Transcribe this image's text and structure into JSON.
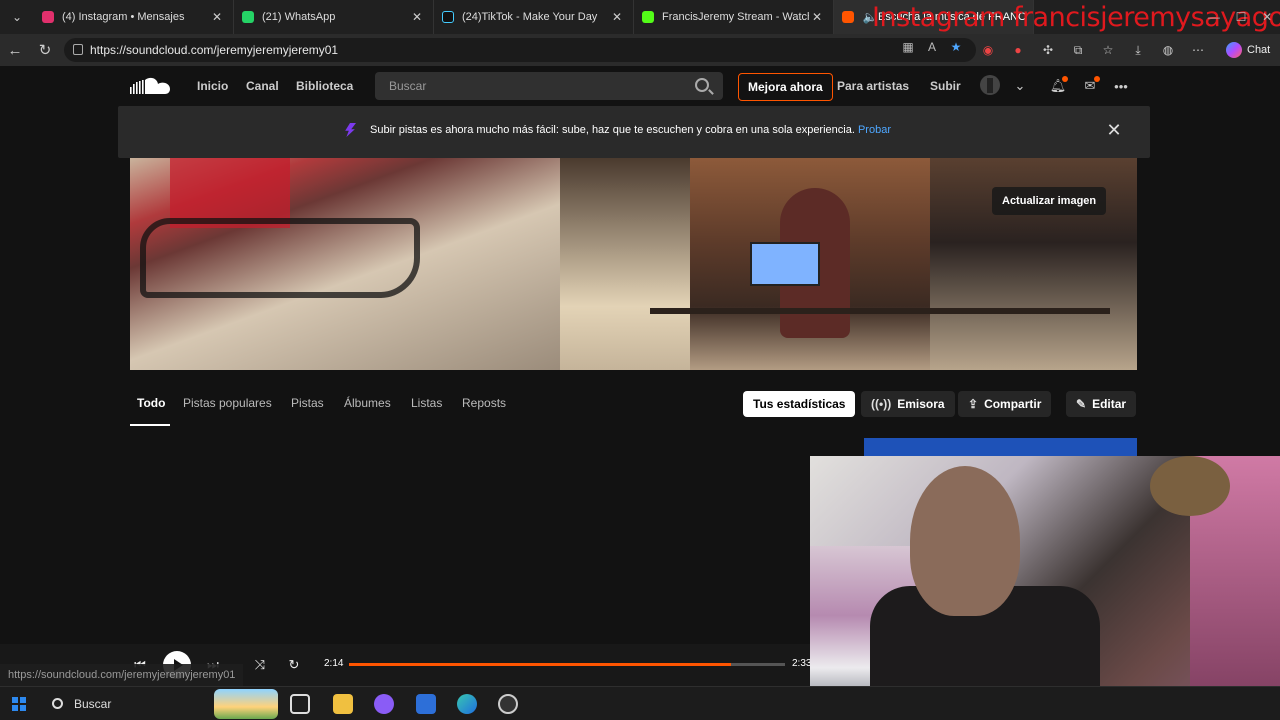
{
  "browser": {
    "tabs": [
      {
        "title": "(4) Instagram • Mensajes",
        "color": "#e1306c"
      },
      {
        "title": "(21) WhatsApp",
        "color": "#25d366"
      },
      {
        "title": "(24)TikTok - Make Your Day",
        "color": "#111111"
      },
      {
        "title": "FrancisJeremy Stream - Watch Live",
        "color": "#53fc18"
      },
      {
        "title": "Escucha la música de FRANCI",
        "color": "#ff5500"
      }
    ],
    "overlay_text": "Instagram francisjeremysayago",
    "url": "https://soundcloud.com/jeremyjeremyjeremy01",
    "chat_label": "Chat",
    "win_controls": [
      "—",
      "☐",
      "✕"
    ]
  },
  "soundcloud": {
    "nav": [
      "Inicio",
      "Canal",
      "Biblioteca"
    ],
    "search_placeholder": "Buscar",
    "upgrade_label": "Mejora ahora",
    "for_artists": "Para artistas",
    "upload": "Subir",
    "notice": {
      "text": "Subir pistas es ahora mucho más fácil: sube, haz que te escuchen y cobra en una sola experiencia.",
      "link": "Probar"
    },
    "update_image": "Actualizar imagen",
    "profile_tabs": [
      "Todo",
      "Pistas populares",
      "Pistas",
      "Álbumes",
      "Listas",
      "Reposts"
    ],
    "actions": {
      "stats": "Tus estadísticas",
      "station": "Emisora",
      "share": "Compartir",
      "edit": "Editar"
    }
  },
  "player": {
    "elapsed": "2:14",
    "duration": "2:33",
    "progress": 0.876,
    "accent": "#ff5500"
  },
  "status_url": "https://soundcloud.com/jeremyjeremyjeremy01",
  "taskbar": {
    "search": "Buscar"
  }
}
